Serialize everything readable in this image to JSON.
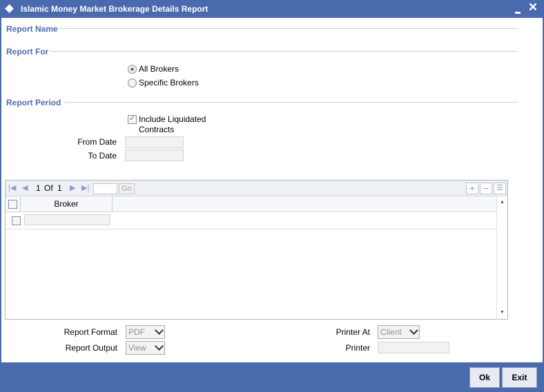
{
  "window": {
    "title": "Islamic Money Market Brokerage Details Report"
  },
  "sections": {
    "report_name": "Report Name",
    "report_for": "Report For",
    "report_period": "Report Period"
  },
  "report_for": {
    "options": [
      {
        "label": "All Brokers",
        "selected": true
      },
      {
        "label": "Specific Brokers",
        "selected": false
      }
    ]
  },
  "report_period": {
    "include_liquidated_line1": "Include Liquidated",
    "include_liquidated_line2": "Contracts",
    "include_liquidated_checked": true,
    "from_date_label": "From Date",
    "from_date_value": "",
    "to_date_label": "To Date",
    "to_date_value": ""
  },
  "grid": {
    "pager_current": "1",
    "pager_of": "Of",
    "pager_total": "1",
    "go_label": "Go",
    "columns": [
      "Broker"
    ],
    "rows": [
      {
        "broker": ""
      }
    ]
  },
  "output": {
    "report_format_label": "Report Format",
    "report_format_value": "PDF",
    "report_output_label": "Report Output",
    "report_output_value": "View",
    "printer_at_label": "Printer At",
    "printer_at_value": "Client",
    "printer_label": "Printer",
    "printer_value": ""
  },
  "buttons": {
    "ok": "Ok",
    "exit": "Exit"
  },
  "colors": {
    "frame": "#4a6aae",
    "section_header": "#4a6fb0"
  }
}
